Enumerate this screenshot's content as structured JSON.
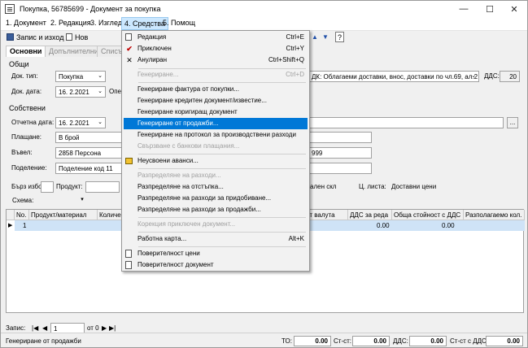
{
  "window": {
    "title": "Покупка, 56785699 - Документ за покупка"
  },
  "menubar": [
    {
      "label": "1. Документ"
    },
    {
      "label": "2. Редакция"
    },
    {
      "label": "3. Изглед"
    },
    {
      "label": "4. Средства"
    },
    {
      "label": "5. Помощ"
    }
  ],
  "toolbar": {
    "save_exit": "Запис и изход",
    "new": "Нов"
  },
  "tabs": [
    "Основни",
    "Допълнителни",
    "Списъ"
  ],
  "general": {
    "section": "Общи",
    "doc_type_label": "Док. тип:",
    "doc_type": "Покупка",
    "doc_date_label": "Док. дата:",
    "doc_date": "16.  2.2021",
    "ope_label": "Опе",
    "vat_desc": "ДК: Облагаеми доставки, внос, доставки по чл.69, ал.2",
    "vat_label": "ДДС:",
    "vat_value": "20"
  },
  "own": {
    "section": "Собствени",
    "report_date_label": "Отчетна дата:",
    "report_date": "16.  2.2021",
    "payment_label": "Плащане:",
    "payment": "В брой",
    "entered_label": "Въвел:",
    "entered": "2858 Персона",
    "entered_right": "999",
    "division_label": "Поделение:",
    "division": "Поделение код 11"
  },
  "filters": {
    "quick_label": "Бърз избор",
    "product_label": "Продукт:",
    "warehouse_text": "ален скл",
    "price_list_label": "Ц. листа:",
    "price_list": "Доставни цени",
    "scheme_label": "Схема:"
  },
  "grid": {
    "headers": [
      "No.",
      "Продукт/материал",
      "Количе",
      "т-ст валута",
      "ДДС за реда",
      "Обща стойност с ДДС",
      "Разполагаемо кол."
    ],
    "row": {
      "no": "1",
      "vat": "0.00",
      "total": "0.00"
    }
  },
  "nav": {
    "label": "Запис:",
    "page": "1",
    "of": "от 0"
  },
  "status": {
    "text": "Генериране от продажби",
    "to_label": "ТО:",
    "to": "0.00",
    "cost_label": "Ст-ст:",
    "cost": "0.00",
    "vat_label": "ДДС:",
    "vat": "0.00",
    "costvat_label": "Ст-ст с ДДС:",
    "costvat": "0.00"
  },
  "menu": {
    "items": [
      {
        "label": "Редакция",
        "shortcut": "Ctrl+E",
        "icon": "edit-icon"
      },
      {
        "label": "Приключен",
        "shortcut": "Ctrl+Y",
        "icon": "check-icon"
      },
      {
        "label": "Анулиран",
        "shortcut": "Ctrl+Shift+Q",
        "icon": "cross-icon"
      },
      {
        "label": "Генериране...",
        "shortcut": "Ctrl+D"
      },
      {
        "label": "Генериране фактура от покупки..."
      },
      {
        "label": "Генериране кредитен документ/известие..."
      },
      {
        "label": "Генериране коригиращ документ"
      },
      {
        "label": "Генериране от продажби..."
      },
      {
        "label": "Генериране на протокол за производствени разходи"
      },
      {
        "label": "Свързване с банкови плащания..."
      },
      {
        "label": "Неусвоени аванси..."
      },
      {
        "label": "Разпределяне на разходи..."
      },
      {
        "label": "Разпределяне на отстъпка..."
      },
      {
        "label": "Разпределяне на разходи за придобиване..."
      },
      {
        "label": "Разпределяне на разходи за продажби..."
      },
      {
        "label": "Корекция приключен документ..."
      },
      {
        "label": "Работна карта...",
        "shortcut": "Alt+K"
      },
      {
        "label": "Поверителност цени"
      },
      {
        "label": "Поверителност документ"
      }
    ]
  }
}
